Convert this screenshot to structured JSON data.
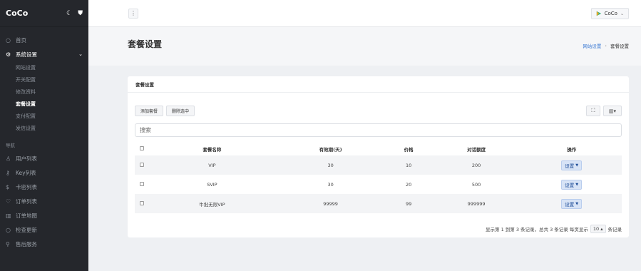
{
  "sidebar": {
    "brand": "CoCo",
    "items_top": [
      {
        "label": "首页",
        "icon": "home-icon"
      },
      {
        "label": "系统设置",
        "icon": "gear-icon"
      }
    ],
    "sub_items": [
      "网站设置",
      "开关配置",
      "修改资料",
      "套餐设置",
      "支付配置",
      "发信设置"
    ],
    "nav_head": "导航",
    "nav_items": [
      "用户列表",
      "Key列表",
      "卡密列表",
      "订单列表",
      "订单地图",
      "检查更新",
      "售后服务"
    ]
  },
  "topbar": {
    "user": "CoCo"
  },
  "page": {
    "title": "套餐设置",
    "crumb_link": "网站设置",
    "crumb_current": "套餐设置"
  },
  "card": {
    "title": "套餐设置",
    "add_label": "添加套餐",
    "delete_label": "删除选中",
    "search_placeholder": "搜索",
    "columns": [
      "套餐名称",
      "有效期(天)",
      "价格",
      "对话额度",
      "操作"
    ],
    "rows": [
      {
        "name": "VIP",
        "days": "30",
        "price": "10",
        "quota": "200",
        "op": "设置"
      },
      {
        "name": "SVIP",
        "days": "30",
        "price": "20",
        "quota": "500",
        "op": "设置"
      },
      {
        "name": "牛批无限VIP",
        "days": "99999",
        "price": "99",
        "quota": "999999",
        "op": "设置"
      }
    ],
    "pager_text": "显示第 1 到第 3 条记录，总共 3 条记录  每页显示",
    "page_size": "10",
    "pager_suffix": "条记录"
  }
}
